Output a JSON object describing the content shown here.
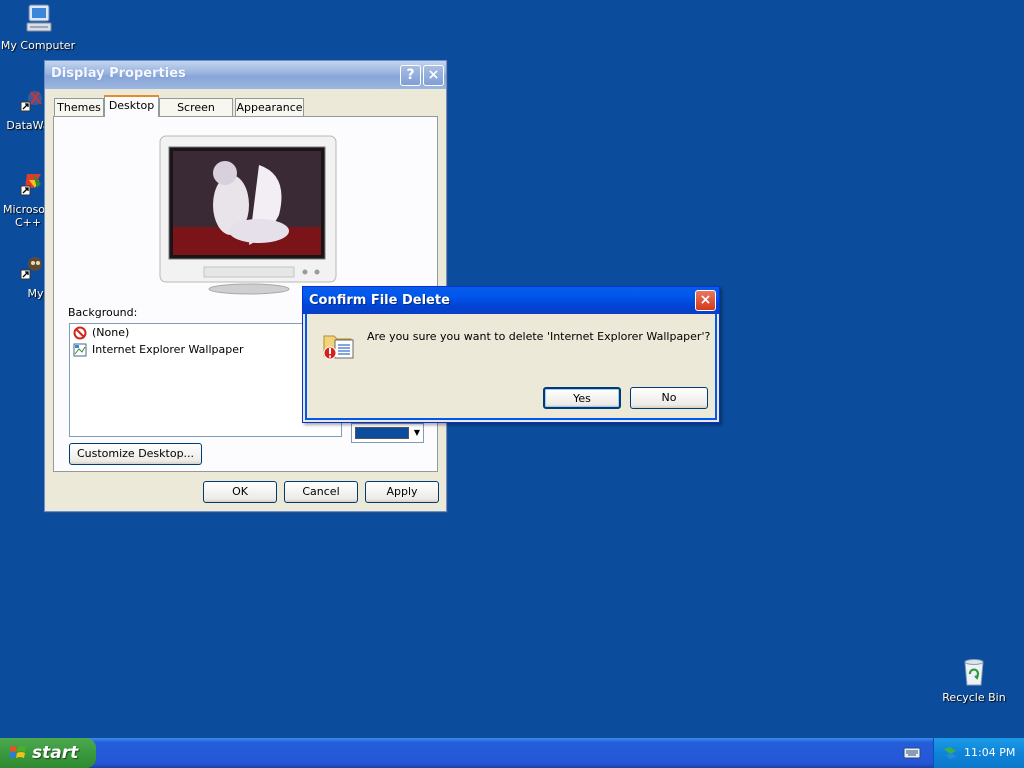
{
  "desktop": {
    "background_color": "#0b4d9c",
    "icons": [
      {
        "label": "My Computer",
        "icon": "my-computer-icon"
      },
      {
        "label": "DataWa",
        "icon": "datawa-shortcut-icon"
      },
      {
        "label": "Microsoft C++",
        "icon": "microsoft-cpp-shortcut-icon"
      },
      {
        "label": "Myp",
        "icon": "myp-shortcut-icon"
      },
      {
        "label": "Recycle Bin",
        "icon": "recycle-bin-icon"
      }
    ]
  },
  "display_properties": {
    "title": "Display Properties",
    "help_label": "?",
    "close_label": "×",
    "tabs": [
      "Themes",
      "Desktop",
      "Screen Saver",
      "Appearance"
    ],
    "active_tab": "Desktop",
    "background_label": "Background:",
    "background_items": [
      "(None)",
      "Internet Explorer Wallpaper"
    ],
    "customize_label": "Customize Desktop...",
    "color_swatch": "#0b4d9c",
    "ok_label": "OK",
    "cancel_label": "Cancel",
    "apply_label": "Apply"
  },
  "confirm_dialog": {
    "title": "Confirm File Delete",
    "close_label": "×",
    "message": "Are you sure you want to delete 'Internet Explorer Wallpaper'?",
    "yes_label": "Yes",
    "no_label": "No"
  },
  "taskbar": {
    "start_label": "start",
    "clock": "11:04 PM"
  }
}
